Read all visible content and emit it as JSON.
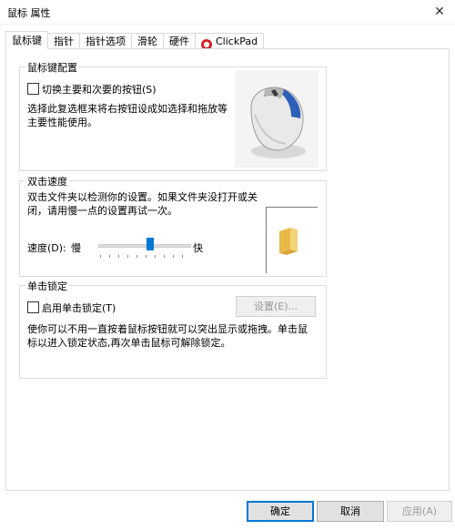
{
  "window": {
    "title": "鼠标 属性",
    "close_icon": "✕"
  },
  "tabs": [
    {
      "label": "鼠标键",
      "active": true
    },
    {
      "label": "指针",
      "active": false
    },
    {
      "label": "指针选项",
      "active": false
    },
    {
      "label": "滑轮",
      "active": false
    },
    {
      "label": "硬件",
      "active": false
    },
    {
      "label": "ClickPad",
      "active": false,
      "icon": "clickpad-icon"
    }
  ],
  "button_config": {
    "title": "鼠标键配置",
    "checkbox_label": "切换主要和次要的按钮(S)",
    "checked": false,
    "description": "选择此复选框来将右按钮设成如选择和拖放等主要性能使用。"
  },
  "double_click": {
    "title": "双击速度",
    "description": "双击文件夹以检测你的设置。如果文件夹没打开或关闭，请用慢一点的设置再试一次。",
    "speed_label": "速度(D):",
    "slow_label": "慢",
    "fast_label": "快",
    "speed_value": 0.5
  },
  "click_lock": {
    "title": "单击锁定",
    "checkbox_label": "启用单击锁定(T)",
    "checked": false,
    "settings_button": "设置(E)...",
    "description": "使你可以不用一直按着鼠标按钮就可以突出显示或拖拽。单击鼠标以进入锁定状态,再次单击鼠标可解除锁定。"
  },
  "footer": {
    "ok": "确定",
    "cancel": "取消",
    "apply": "应用(A)"
  },
  "colors": {
    "accent": "#0078d7",
    "clickpad": "#d51f26"
  }
}
